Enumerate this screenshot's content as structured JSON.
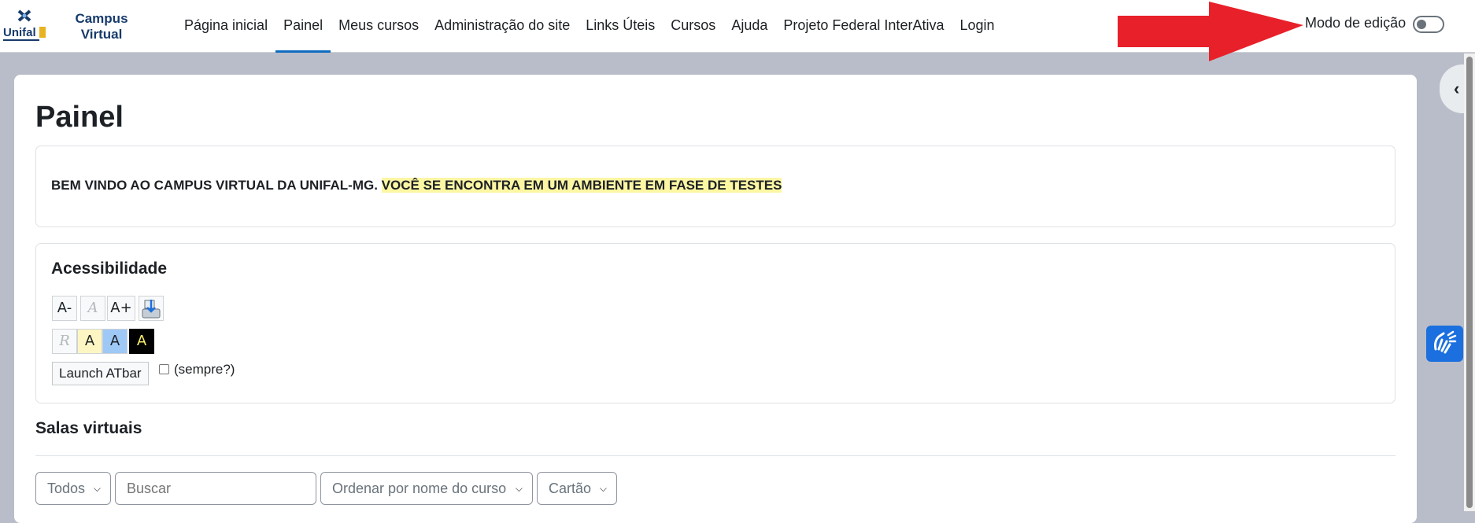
{
  "brand": {
    "line1": "Campus",
    "line2": "Virtual",
    "logo_text": "Unifal"
  },
  "nav": {
    "items": [
      {
        "label": "Página inicial"
      },
      {
        "label": "Painel"
      },
      {
        "label": "Meus cursos"
      },
      {
        "label": "Administração do site"
      },
      {
        "label": "Links Úteis"
      },
      {
        "label": "Cursos"
      },
      {
        "label": "Ajuda"
      },
      {
        "label": "Projeto Federal InterAtiva"
      },
      {
        "label": "Login"
      }
    ],
    "active": "Painel"
  },
  "edit_mode": {
    "label": "Modo de edição",
    "enabled": false
  },
  "page": {
    "title": "Painel"
  },
  "welcome": {
    "text": "BEM VINDO AO CAMPUS VIRTUAL DA UNIFAL-MG.",
    "highlight": "VOCÊ SE ENCONTRA EM UM AMBIENTE EM FASE DE TESTES"
  },
  "accessibility": {
    "title": "Acessibilidade",
    "row1": [
      "A-",
      "A",
      "A+"
    ],
    "row2": [
      "R",
      "A",
      "A",
      "A"
    ],
    "launch_label": "Launch ATbar",
    "always_label": "(sempre?)"
  },
  "courses": {
    "title": "Salas virtuais",
    "filter": "Todos",
    "search_placeholder": "Buscar",
    "sort": "Ordenar por nome do curso",
    "view": "Cartão"
  },
  "colors": {
    "accent": "#0f6cbf",
    "highlight": "#fdf6a3",
    "arrow": "#e8202a",
    "hand_button": "#1b6fde"
  },
  "icons": {
    "drawer": "chevron-left-icon",
    "hand": "sign-language-hands-icon",
    "save": "save-download-icon",
    "dropdown": "chevron-down-icon"
  }
}
